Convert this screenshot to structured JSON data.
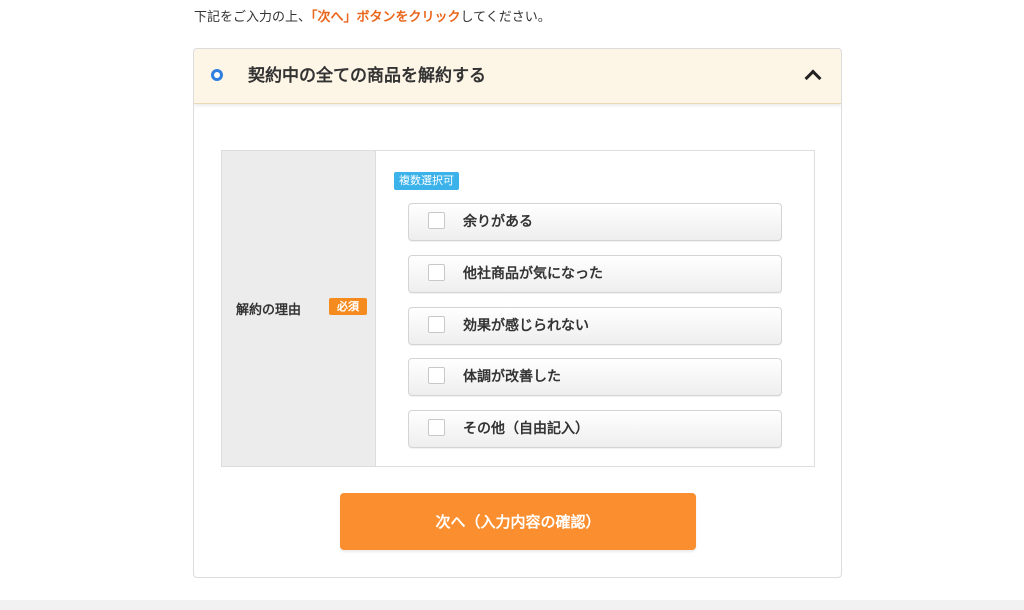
{
  "intro": {
    "before": "下記をご入力の上、",
    "highlight": "「次へ」ボタンをクリック",
    "after": "してください。"
  },
  "panel": {
    "title": "契約中の全ての商品を解約する"
  },
  "form": {
    "field_label": "解約の理由",
    "required_badge": "必須",
    "multi_badge": "複数選択可",
    "options": [
      {
        "label": "余りがある",
        "checked": false
      },
      {
        "label": "他社商品が気になった",
        "checked": false
      },
      {
        "label": "効果が感じられない",
        "checked": false
      },
      {
        "label": "体調が改善した",
        "checked": false
      },
      {
        "label": "その他（自由記入）",
        "checked": false
      }
    ]
  },
  "next_button": {
    "label": "次へ（入力内容の確認）"
  },
  "colors": {
    "accent_orange": "#fb8f2f",
    "highlight_text": "#e8671b",
    "required_badge": "#f58b1f",
    "multi_badge": "#3bb2ea",
    "header_bg": "#fdf5e6",
    "radio_blue": "#2f7fe0"
  }
}
